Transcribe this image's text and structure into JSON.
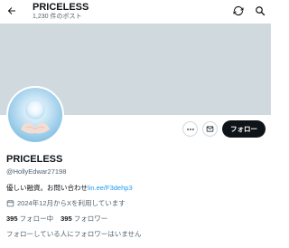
{
  "header": {
    "title": "PRICELESS",
    "post_count": "1,230 件のポスト"
  },
  "profile": {
    "display_name": "PRICELESS",
    "handle": "@HollyEdwar27198",
    "bio_text": "優しい融資。お問い合わせ",
    "bio_link": "lin.ee/F3dehp3",
    "joined": "2024年12月からXを利用しています",
    "following_count": "395",
    "following_label": "フォロー中",
    "followers_count": "395",
    "followers_label": "フォロワー",
    "followed_by_note": "フォローしている人にフォロワーはいません"
  },
  "actions": {
    "follow_label": "フォロー"
  },
  "icons": [
    "back-arrow-icon",
    "refresh-icon",
    "search-icon",
    "more-icon",
    "message-icon",
    "calendar-icon"
  ],
  "colors": {
    "banner": "#cfd9de",
    "link": "#1d9bf0",
    "follow_button": "#0f1419",
    "secondary_text": "#536471"
  }
}
